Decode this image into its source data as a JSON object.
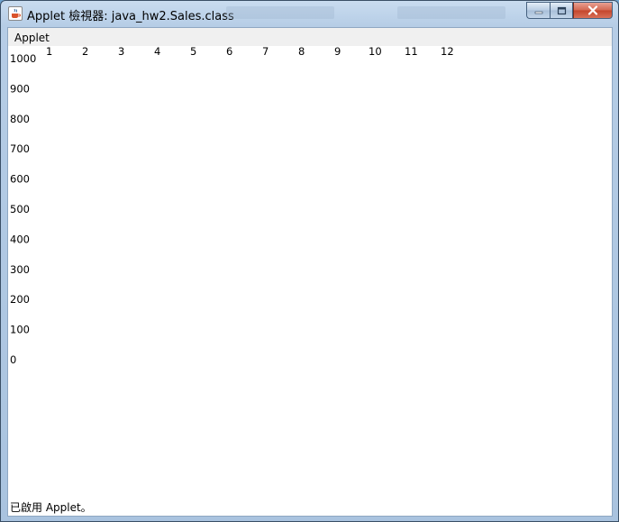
{
  "window": {
    "title": "Applet 檢視器: java_hw2.Sales.class"
  },
  "menu": {
    "items": [
      "Applet"
    ]
  },
  "chart_data": {
    "type": "bar",
    "categories": [
      "1",
      "2",
      "3",
      "4",
      "5",
      "6",
      "7",
      "8",
      "9",
      "10",
      "11",
      "12"
    ],
    "values": [],
    "yticks": [
      "1000",
      "900",
      "800",
      "700",
      "600",
      "500",
      "400",
      "300",
      "200",
      "100",
      "0"
    ],
    "ylim": [
      0,
      1000
    ],
    "title": "",
    "xlabel": "",
    "ylabel": ""
  },
  "status": {
    "text": "已啟用 Applet。"
  },
  "icons": {
    "app": "java-coffee-icon",
    "minimize": "minimize-icon",
    "maximize": "maximize-icon",
    "close": "close-icon"
  },
  "colors": {
    "title_bar": "#b6cde6",
    "close_button": "#c4452b",
    "canvas": "#ffffff"
  }
}
